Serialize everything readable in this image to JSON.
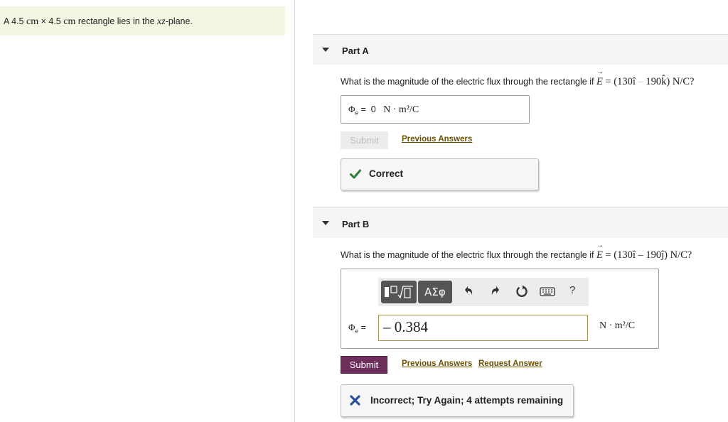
{
  "problem": {
    "prefix": "A 4.5",
    "unit1": "cm",
    "times": "×",
    "num2": "4.5",
    "unit2": "cm",
    "middle": "rectangle lies in the",
    "plane_var": "xz",
    "suffix": "-plane."
  },
  "part_a": {
    "title": "Part A",
    "question_prefix": "What is the magnitude of the electric flux through the rectangle if",
    "field_symbol": "E",
    "equals": "=",
    "field_value_1": "(130",
    "unit_vec_1": "î",
    "operator": "–",
    "field_value_2": "190",
    "unit_vec_2": "k̂",
    "field_close": ")",
    "field_unit": "N/C?",
    "phi_label": "Φ",
    "phi_sub": "e",
    "phi_eq": "=",
    "answer_value": "0",
    "answer_unit": "N · m²/C",
    "submit_label": "Submit",
    "previous_answers_label": "Previous Answers",
    "feedback": {
      "status": "correct",
      "text": "Correct",
      "icon": "checkmark-icon",
      "color": "#2e7d32"
    }
  },
  "part_b": {
    "title": "Part B",
    "question_prefix": "What is the magnitude of the electric flux through the rectangle if",
    "field_symbol": "E",
    "equals": "=",
    "field_value_1": "(130",
    "unit_vec_1": "î",
    "operator": "–",
    "field_value_2": "190",
    "unit_vec_2": "ĵ",
    "field_close": ")",
    "field_unit": "N/C?",
    "toolbar": {
      "templates_icon": "templates-icon",
      "greek_label": "ΑΣφ",
      "undo_icon": "undo-icon",
      "redo_icon": "redo-icon",
      "reset_icon": "reset-icon",
      "keyboard_icon": "keyboard-icon",
      "help_label": "?"
    },
    "phi_label": "Φ",
    "phi_sub": "e",
    "phi_eq": "=",
    "answer_value": "– 0.384",
    "answer_unit": "N · m²/C",
    "submit_label": "Submit",
    "previous_answers_label": "Previous Answers",
    "request_answer_label": "Request Answer",
    "feedback": {
      "status": "incorrect",
      "text": "Incorrect; Try Again; 4 attempts remaining",
      "icon": "cross-icon",
      "color": "#2a4ea0"
    }
  },
  "colors": {
    "problem_bg": "#f5f5e4",
    "submit_active": "#6d2e5b",
    "link": "#6b5100",
    "input_border_active": "#a88f4b"
  }
}
